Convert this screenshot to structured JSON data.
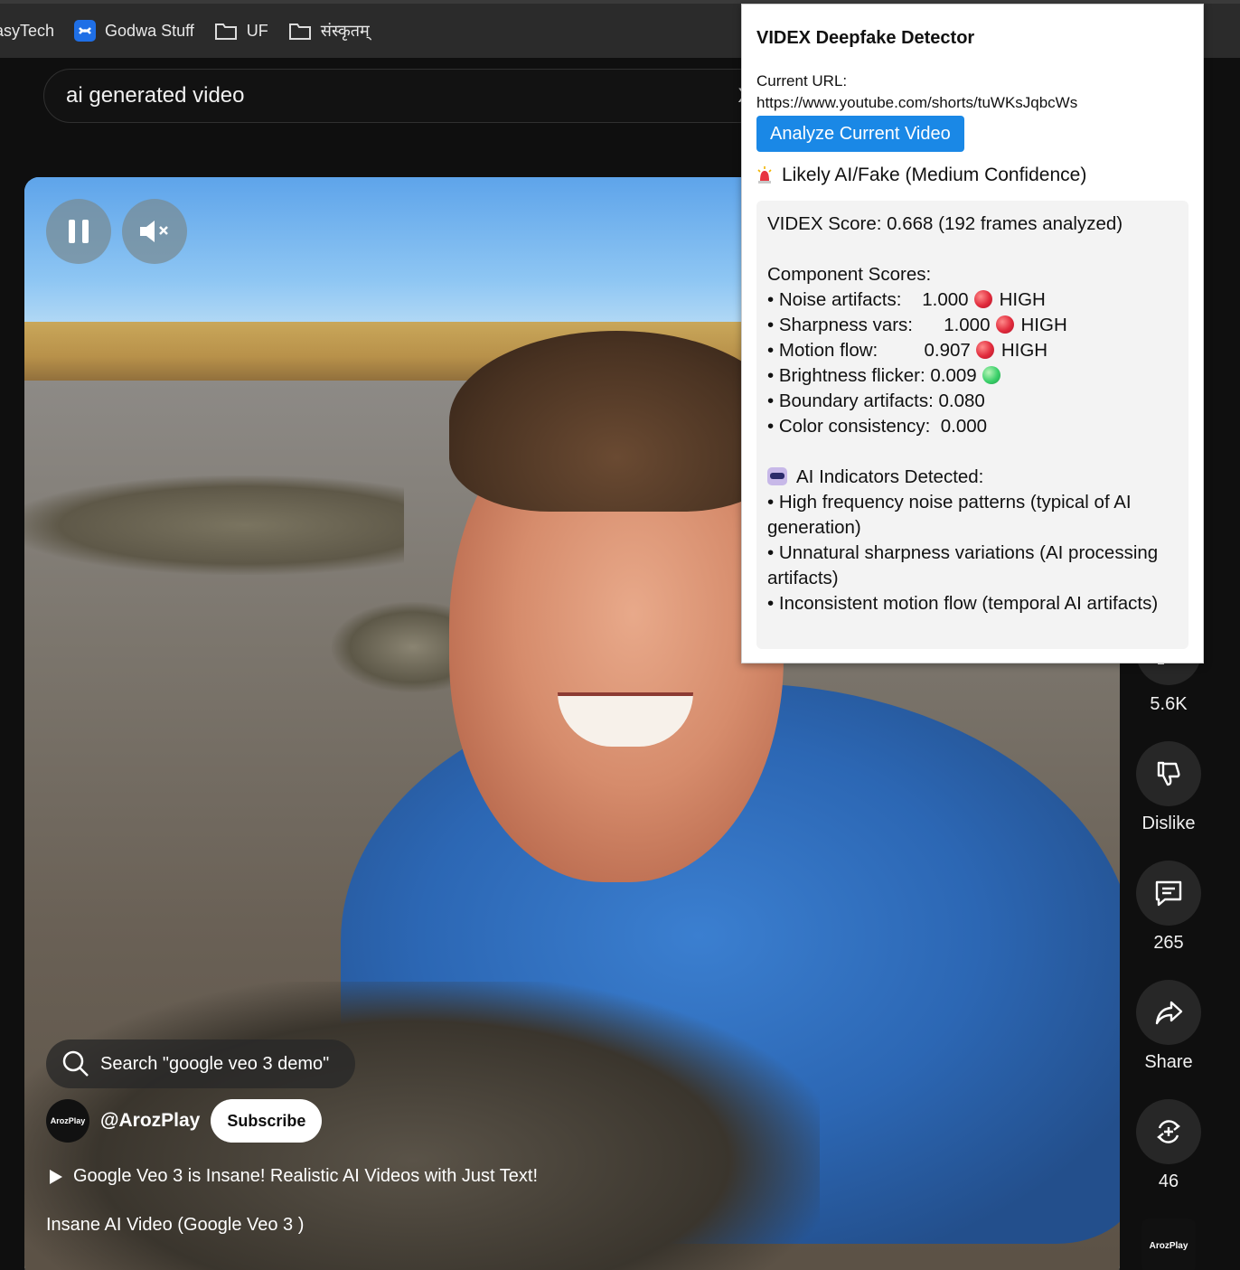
{
  "bookmarks": [
    {
      "label": "asyTech"
    },
    {
      "label": "Godwa Stuff"
    },
    {
      "label": "UF"
    },
    {
      "label": "संस्कृतम्"
    }
  ],
  "search": {
    "query": "ai generated video",
    "clear": "X"
  },
  "video": {
    "shorts_search": "Search \"google veo 3 demo\"",
    "channel_avatar": "ArozPlay",
    "channel": "@ArozPlay",
    "subscribe": "Subscribe",
    "linked_video": "Google Veo 3 is Insane! Realistic AI Videos with Just Text!",
    "title": "Insane AI Video (Google Veo 3 )"
  },
  "actions": {
    "like_count": "5.6K",
    "dislike": "Dislike",
    "comments": "265",
    "share": "Share",
    "remix": "46",
    "avatar": "ArozPlay"
  },
  "popup": {
    "title": "VIDEX Deepfake Detector",
    "url_label": "Current URL:",
    "url": "https://www.youtube.com/shorts/tuWKsJqbcWs",
    "analyze_button": "Analyze Current Video",
    "verdict": "Likely AI/Fake (Medium Confidence)",
    "score_line": "VIDEX Score: 0.668 (192 frames analyzed)",
    "component_header": "Component Scores:",
    "components": [
      {
        "name": "• Noise artifacts:",
        "value": "1.000",
        "level": "HIGH",
        "dot": "red"
      },
      {
        "name": "• Sharpness vars:",
        "value": "1.000",
        "level": "HIGH",
        "dot": "red"
      },
      {
        "name": "• Motion flow:",
        "value": "0.907",
        "level": "HIGH",
        "dot": "red"
      },
      {
        "name": "• Brightness flicker:",
        "value": "0.009",
        "level": "",
        "dot": "green"
      },
      {
        "name": "• Boundary artifacts:",
        "value": "0.080",
        "level": "",
        "dot": ""
      },
      {
        "name": "• Color consistency:",
        "value": "0.000",
        "level": "",
        "dot": ""
      }
    ],
    "indicators_header": "AI Indicators Detected:",
    "indicators": [
      "• High frequency noise patterns (typical of AI generation)",
      "• Unnatural sharpness variations (AI processing artifacts)",
      "• Inconsistent motion flow (temporal AI artifacts)"
    ]
  },
  "colors": {
    "accent": "#1a88e6",
    "high": "#e12b3c",
    "low": "#3bd06a",
    "popup_bg": "#ffffff",
    "results_bg": "#f3f3f3"
  }
}
